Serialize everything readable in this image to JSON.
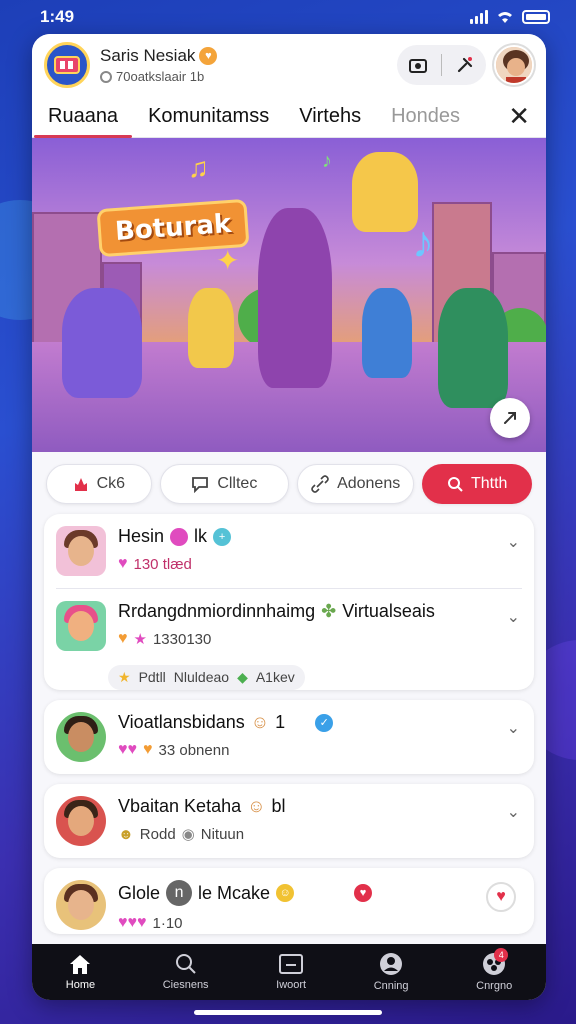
{
  "status_bar": {
    "time": "1:49"
  },
  "header": {
    "title": "Saris Nesiak",
    "subtitle": "70oatkslaair 1b"
  },
  "tabs": [
    {
      "label": "Ruaana",
      "active": true
    },
    {
      "label": "Komunitamss",
      "active": false
    },
    {
      "label": "Virtehs",
      "active": false
    },
    {
      "label": "Hondes",
      "active": false,
      "dimmed": true
    }
  ],
  "hero": {
    "sign_text": "Boturak"
  },
  "actions": [
    {
      "label": "Ck6",
      "icon": "flame-icon",
      "primary": false
    },
    {
      "label": "Clltec",
      "icon": "comment-icon",
      "primary": false
    },
    {
      "label": "Adonens",
      "icon": "link-icon",
      "primary": false
    },
    {
      "label": "Thtth",
      "icon": "search-icon",
      "primary": true
    }
  ],
  "list": [
    {
      "name": "Hesin",
      "emoji": "lk",
      "meta": "130 tlæd"
    },
    {
      "name": "Rrdangdnmiordinnhaimg",
      "suffix": "Virtualseais",
      "meta": "1330130",
      "tags": [
        "Pdtll",
        "Nluldeao",
        "A1kev"
      ]
    },
    {
      "name": "Vioatlansbidans",
      "emoji": "1",
      "meta": "33 obnenn"
    },
    {
      "name": "Vbaitan Ketaha",
      "emoji": "bl",
      "meta_1": "Rodd",
      "meta_2": "Nituun"
    },
    {
      "name": "Glole",
      "mid": "n",
      "name_2": "le Mcake",
      "meta": "1·10"
    }
  ],
  "bottom_nav": [
    {
      "label": "Home",
      "icon": "home-icon",
      "active": true
    },
    {
      "label": "Ciesnens",
      "icon": "search-icon",
      "active": false
    },
    {
      "label": "Iwoort",
      "icon": "inbox-icon",
      "active": false
    },
    {
      "label": "Cnning",
      "icon": "profile-icon",
      "active": false
    },
    {
      "label": "Cnrgno",
      "icon": "community-icon",
      "active": false,
      "badge": "4"
    }
  ],
  "colors": {
    "accent": "#e2304a",
    "tab_underline": "#d73a55",
    "background_top": "#1d3fb8"
  }
}
